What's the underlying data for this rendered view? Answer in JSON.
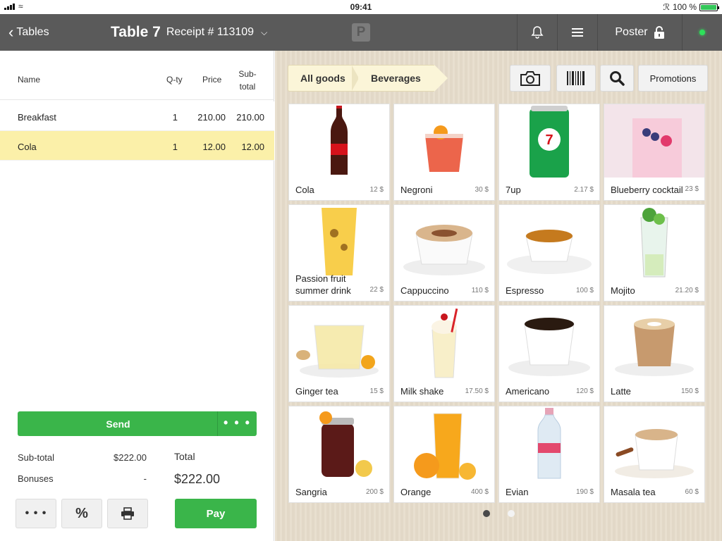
{
  "status_bar": {
    "time": "09:41",
    "battery": "100 %"
  },
  "nav": {
    "back_label": "Tables",
    "table_title": "Table 7",
    "receipt_label": "Receipt # 113109",
    "logo_letter": "P",
    "poster_label": "Poster"
  },
  "order": {
    "columns": {
      "name": "Name",
      "qty": "Q-ty",
      "price": "Price",
      "subtotal": "Sub-total"
    },
    "items": [
      {
        "name": "Breakfast",
        "qty": "1",
        "price": "210.00",
        "subtotal": "210.00"
      },
      {
        "name": "Cola",
        "qty": "1",
        "price": "12.00",
        "subtotal": "12.00"
      }
    ],
    "send_label": "Send",
    "send_more": "• • •",
    "subtotal_label": "Sub-total",
    "subtotal_value": "$222.00",
    "bonuses_label": "Bonuses",
    "bonuses_value": "-",
    "total_label": "Total",
    "total_value": "$222.00",
    "more_label": "• • •",
    "percent_label": "%",
    "pay_label": "Pay"
  },
  "catalog": {
    "breadcrumbs": [
      "All goods",
      "Beverages"
    ],
    "promotions_label": "Promotions",
    "products": [
      {
        "name": "Cola",
        "price": "12 $"
      },
      {
        "name": "Negroni",
        "price": "30 $"
      },
      {
        "name": "7up",
        "price": "2.17 $"
      },
      {
        "name": "Blueberry cocktail",
        "price": "23 $"
      },
      {
        "name": "Passion fruit summer drink",
        "price": "22 $"
      },
      {
        "name": "Cappuccino",
        "price": "110 $"
      },
      {
        "name": "Espresso",
        "price": "100 $"
      },
      {
        "name": "Mojito",
        "price": "21.20 $"
      },
      {
        "name": "Ginger tea",
        "price": "15 $"
      },
      {
        "name": "Milk shake",
        "price": "17.50 $"
      },
      {
        "name": "Americano",
        "price": "120 $"
      },
      {
        "name": "Latte",
        "price": "150 $"
      },
      {
        "name": "Sangria",
        "price": "200 $"
      },
      {
        "name": "Orange",
        "price": "400 $"
      },
      {
        "name": "Evian",
        "price": "190 $"
      },
      {
        "name": "Masala tea",
        "price": "60 $"
      }
    ],
    "pages": {
      "current": 1,
      "total": 2
    }
  },
  "colors": {
    "accent_green": "#3ab54a",
    "nav_bg": "#5a5a5a",
    "selected_row": "#fbf0a9",
    "status_online": "#2ee05a"
  }
}
